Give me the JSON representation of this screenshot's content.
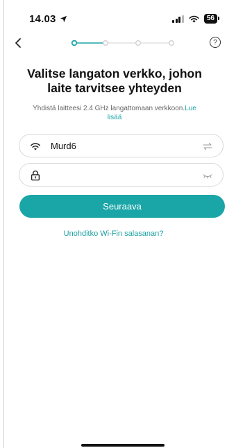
{
  "status_bar": {
    "time": "14.03",
    "battery": "56",
    "icons": [
      "location-arrow-icon",
      "signal-icon",
      "wifi-icon",
      "battery-icon"
    ]
  },
  "nav": {
    "back_icon": "chevron-left-icon",
    "help_label": "?",
    "steps_total": 4,
    "current_step": 1
  },
  "main": {
    "title": "Valitse langaton verkko, johon laite tarvitsee yhteyden",
    "subtitle": "Yhdistä laitteesi 2.4 GHz langattomaan verkkoon.",
    "subtitle_link": "Lue lisää",
    "ssid_field": {
      "value": "Murd6",
      "icon": "wifi-icon",
      "action_icon": "swap-arrows-icon"
    },
    "password_field": {
      "value": "",
      "placeholder": "",
      "icon": "lock-icon",
      "action_icon": "eye-closed-icon"
    },
    "next_button": "Seuraava",
    "forgot_link": "Unohditko Wi-Fin salasanan?"
  },
  "colors": {
    "accent": "#1aa5a7",
    "text": "#111111",
    "muted": "#666666",
    "border": "#d9d9d9"
  }
}
